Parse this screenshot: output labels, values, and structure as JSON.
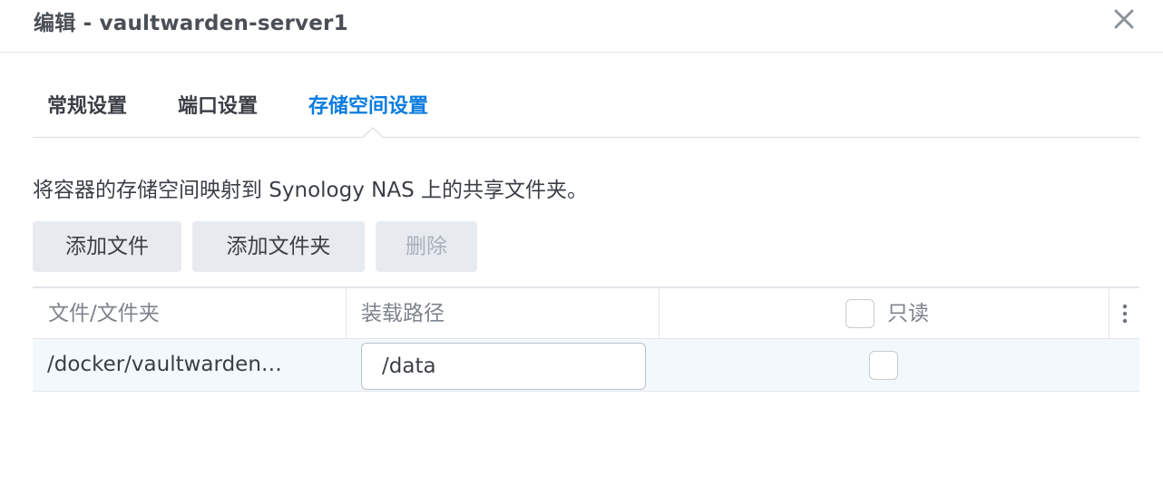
{
  "dialog": {
    "title": "编辑 - vaultwarden-server1"
  },
  "tabs": [
    {
      "label": "常规设置",
      "active": false
    },
    {
      "label": "端口设置",
      "active": false
    },
    {
      "label": "存储空间设置",
      "active": true
    }
  ],
  "description": "将容器的存储空间映射到 Synology NAS 上的共享文件夹。",
  "toolbar": {
    "add_file_label": "添加文件",
    "add_folder_label": "添加文件夹",
    "delete_label": "删除",
    "delete_disabled": true
  },
  "table": {
    "headers": {
      "file_folder": "文件/文件夹",
      "mount_path": "装载路径",
      "read_only": "只读"
    },
    "rows": [
      {
        "file_folder": "/docker/vaultwarden…",
        "mount_path": "/data",
        "read_only": false
      }
    ]
  },
  "colors": {
    "accent": "#0a7ce0",
    "button_bg": "#e7ebf0",
    "row_selected_bg": "#f3f8fd"
  },
  "icons": {
    "close": "close-icon",
    "more": "more-vertical-icon"
  }
}
